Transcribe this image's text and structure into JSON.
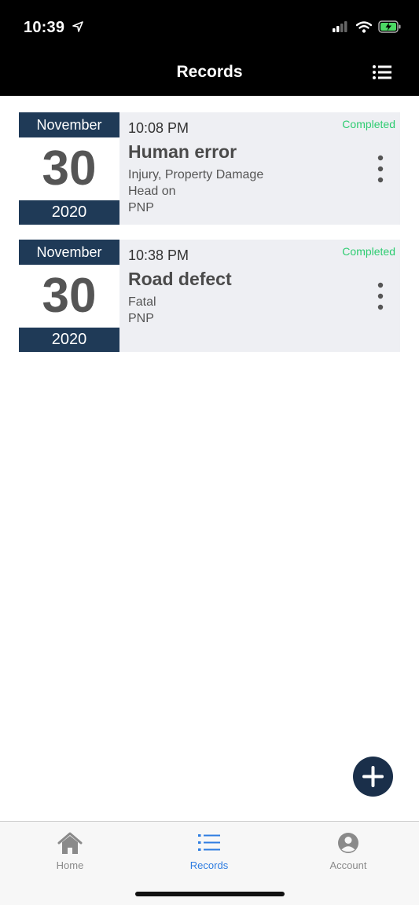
{
  "status_bar": {
    "time": "10:39"
  },
  "nav": {
    "title": "Records"
  },
  "records": [
    {
      "month": "November",
      "day": "30",
      "year": "2020",
      "time": "10:08 PM",
      "status": "Completed",
      "title": "Human error",
      "lines": [
        "Injury, Property Damage",
        "Head on",
        "PNP"
      ]
    },
    {
      "month": "November",
      "day": "30",
      "year": "2020",
      "time": "10:38 PM",
      "status": "Completed",
      "title": "Road defect",
      "lines": [
        "Fatal",
        "PNP"
      ]
    }
  ],
  "tabbar": {
    "tabs": [
      {
        "label": "Home",
        "icon": "home-icon",
        "active": false
      },
      {
        "label": "Records",
        "icon": "list-icon",
        "active": true
      },
      {
        "label": "Account",
        "icon": "account-icon",
        "active": false
      }
    ]
  },
  "colors": {
    "date_band": "#1f3a57",
    "status": "#2ecc71",
    "active_tab": "#2f7de1",
    "fab": "#1a2f4a"
  }
}
